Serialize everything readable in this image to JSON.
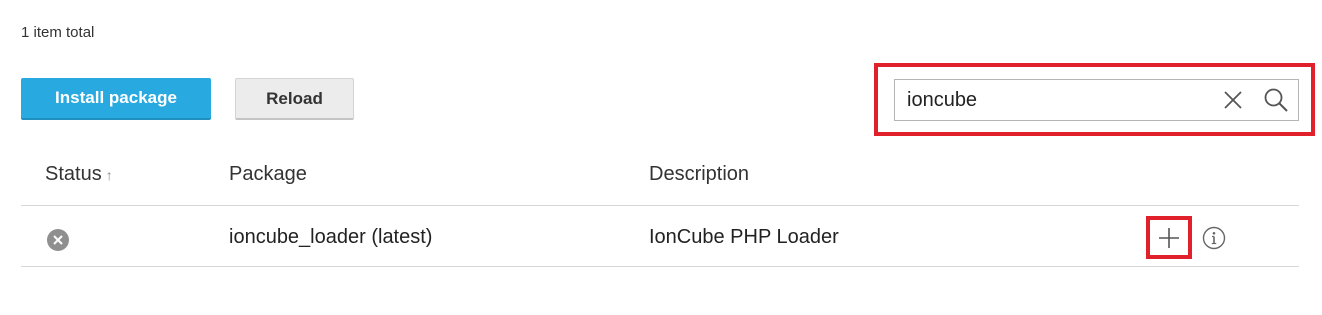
{
  "summary": {
    "total_text": "1 item total"
  },
  "toolbar": {
    "install_label": "Install package",
    "reload_label": "Reload"
  },
  "search": {
    "value": "ioncube",
    "clear_icon": "close-icon",
    "search_icon": "search-icon"
  },
  "table": {
    "columns": [
      {
        "label": "Status",
        "sort_indicator": "↑"
      },
      {
        "label": "Package"
      },
      {
        "label": "Description"
      }
    ],
    "rows": [
      {
        "status_icon": "not-installed-icon",
        "package": "ioncube_loader (latest)",
        "description": "IonCube PHP Loader",
        "actions": [
          "add-icon",
          "info-icon"
        ]
      }
    ]
  },
  "colors": {
    "primary": "#28aae1",
    "highlight": "#e0202a",
    "status_icon": "#8f8f8f"
  }
}
